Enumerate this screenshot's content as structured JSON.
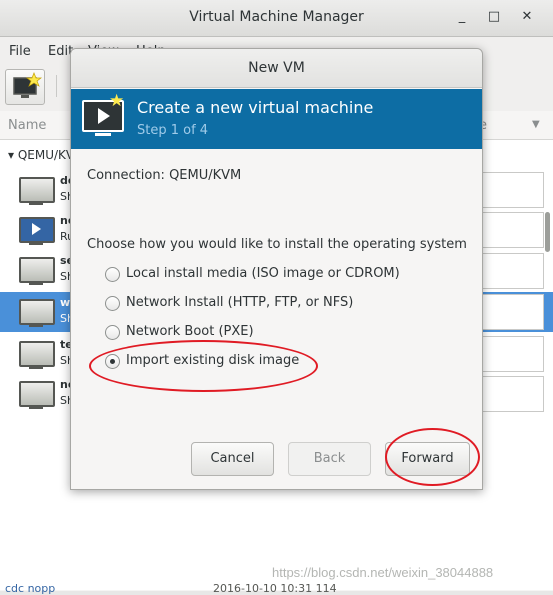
{
  "window": {
    "title": "Virtual Machine Manager",
    "minimize_glyph": "_",
    "maximize_glyph": "□",
    "close_glyph": "✕"
  },
  "menubar": {
    "items": [
      "File",
      "Edit",
      "View",
      "Help"
    ]
  },
  "columns": {
    "name": "Name",
    "right": "e"
  },
  "vm_list": {
    "group": "QEMU/KVM",
    "rows": [
      {
        "n1": "de",
        "n2": "Sh"
      },
      {
        "n1": "ne",
        "n2": "Ru"
      },
      {
        "n1": "se",
        "n2": "Sh"
      },
      {
        "n1": "w",
        "n2": "Sh"
      },
      {
        "n1": "te",
        "n2": "Sh"
      },
      {
        "n1": "ne",
        "n2": "Sh"
      }
    ],
    "bottom_left": "cdc nopp",
    "bottom_mid": "2016-10-10 10:31  114"
  },
  "dialog": {
    "title": "New VM",
    "banner_title": "Create a new virtual machine",
    "banner_step": "Step 1 of 4",
    "connection": "Connection:  QEMU/KVM",
    "prompt": "Choose how you would like to install the operating system",
    "options": [
      {
        "label": "Local install media (ISO image or CDROM)",
        "selected": false
      },
      {
        "label": "Network Install (HTTP, FTP, or NFS)",
        "selected": false
      },
      {
        "label": "Network Boot (PXE)",
        "selected": false
      },
      {
        "label": "Import existing disk image",
        "selected": true
      }
    ],
    "buttons": {
      "cancel": "Cancel",
      "back": "Back",
      "forward": "Forward"
    }
  },
  "annotation_color": "#e01b24",
  "accent": "#0d6da4",
  "watermark": "https://blog.csdn.net/weixin_38044888"
}
